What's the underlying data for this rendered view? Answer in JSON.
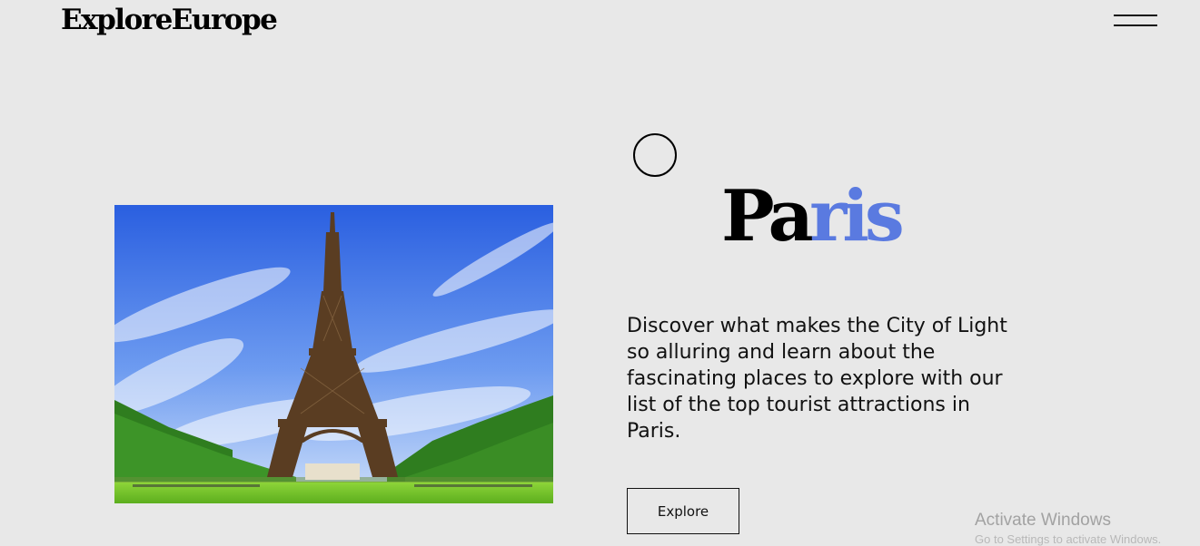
{
  "header": {
    "logo": "ExploreEurope",
    "menu_icon": "hamburger-menu-icon"
  },
  "hero": {
    "image_subject": "eiffel-tower-photo",
    "title_part1": "Pa",
    "title_part2": "ris",
    "description": "Discover what makes the City of Light so alluring and learn about the fascinating places to explore with our list of the top tourist attractions in Paris.",
    "button_label": "Explore",
    "accent_color": "#5a7ae0"
  },
  "os_overlay": {
    "watermark_title": "Activate Windows",
    "watermark_sub": "Go to Settings to activate Windows."
  }
}
